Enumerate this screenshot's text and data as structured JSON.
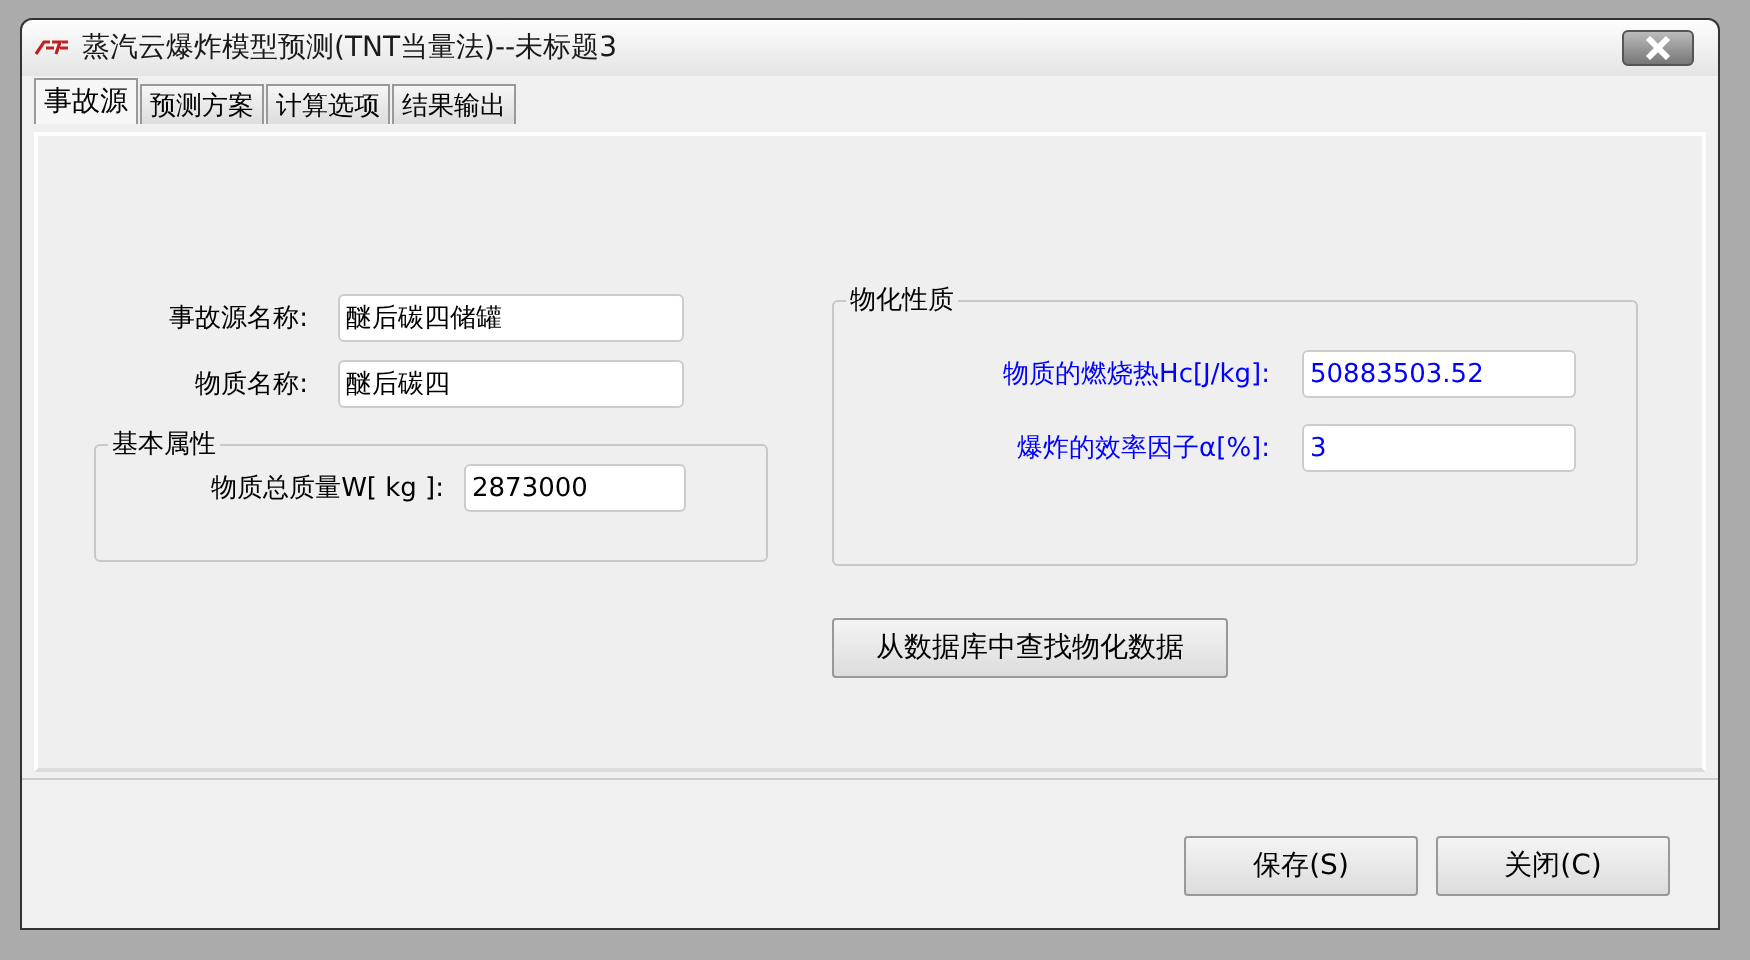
{
  "window": {
    "title": "蒸汽云爆炸模型预测(TNT当量法)--未标题3"
  },
  "tabs": [
    {
      "label": "事故源",
      "selected": true
    },
    {
      "label": "预测方案",
      "selected": false
    },
    {
      "label": "计算选项",
      "selected": false
    },
    {
      "label": "结果输出",
      "selected": false
    }
  ],
  "source_fields": [
    {
      "label": "事故源名称:",
      "value": "醚后碳四储罐"
    },
    {
      "label": "物质名称:",
      "value": "醚后碳四"
    }
  ],
  "basic_group": {
    "title": "基本属性",
    "fields": [
      {
        "label": "物质总质量W[ kg ]:",
        "value": "2873000"
      }
    ]
  },
  "physchem_group": {
    "title": "物化性质",
    "fields": [
      {
        "label": "物质的燃烧热Hc[J/kg]:",
        "value": "50883503.52",
        "color": "#0000ff"
      },
      {
        "label": "爆炸的效率因子α[%]:",
        "value": "3",
        "color": "#0000ff"
      }
    ]
  },
  "lookup_button": "从数据库中查找物化数据",
  "buttons": [
    "保存(S)",
    "关闭(C)"
  ]
}
